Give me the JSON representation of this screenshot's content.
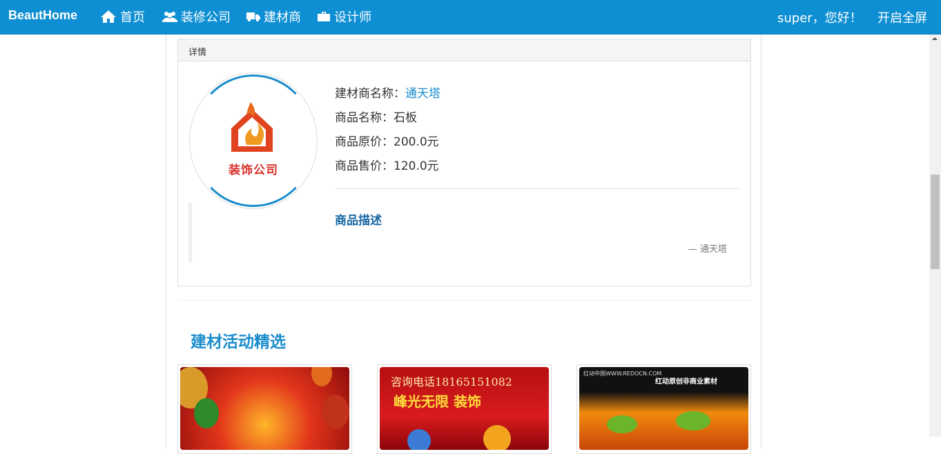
{
  "nav": {
    "brand": "BeautHome",
    "items": [
      {
        "label": "首页",
        "icon": "home-icon"
      },
      {
        "label": "装修公司",
        "icon": "users-icon"
      },
      {
        "label": "建材商",
        "icon": "truck-icon"
      },
      {
        "label": "设计师",
        "icon": "briefcase-icon"
      }
    ],
    "greeting": "super，您好！",
    "fullscreen": "开启全屏"
  },
  "panel": {
    "heading": "详情",
    "logo_text": "装饰公司",
    "seller_label": "建材商名称：",
    "seller_name": "通天塔",
    "product_name_line": "商品名称：石板",
    "original_price_line": "商品原价：200.0元",
    "sale_price_line": "商品售价：120.0元",
    "description_title": "商品描述",
    "quote_source": "— 通天塔"
  },
  "section": {
    "title": "建材活动精选"
  },
  "cards": {
    "card2_caption": "咨询电话18165151082",
    "card2_brand": "峰光无限 装饰",
    "card3_header": "红动中国WWW.REDOCN.COM",
    "card3_title": "红动原创非商业素材"
  },
  "colors": {
    "navbar": "#0e8fd3",
    "accent": "#1a8ccc",
    "description": "#1768a3"
  }
}
